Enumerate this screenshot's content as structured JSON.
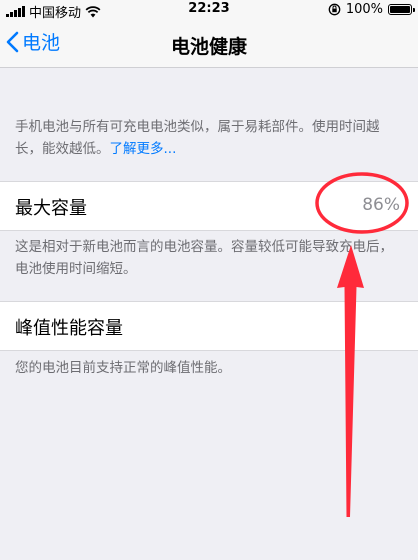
{
  "status_bar": {
    "carrier": "中国移动",
    "time": "22:23",
    "battery_percent": "100%",
    "icons": [
      "signal-icon",
      "wifi-icon",
      "orientation-lock-icon",
      "battery-icon"
    ]
  },
  "nav": {
    "back_label": "电池",
    "title": "电池健康"
  },
  "intro": {
    "text": "手机电池与所有可充电电池类似，属于易耗部件。使用时间越长，能效越低。",
    "link": "了解更多..."
  },
  "max_capacity": {
    "label": "最大容量",
    "value": "86%",
    "footer": "这是相对于新电池而言的电池容量。容量较低可能导致充电后，电池使用时间缩短。"
  },
  "peak_performance": {
    "label": "峰值性能容量",
    "footer": "您的电池目前支持正常的峰值性能。"
  },
  "colors": {
    "accent": "#007aff",
    "background": "#efeff4",
    "annotation": "#ff2a3a"
  }
}
